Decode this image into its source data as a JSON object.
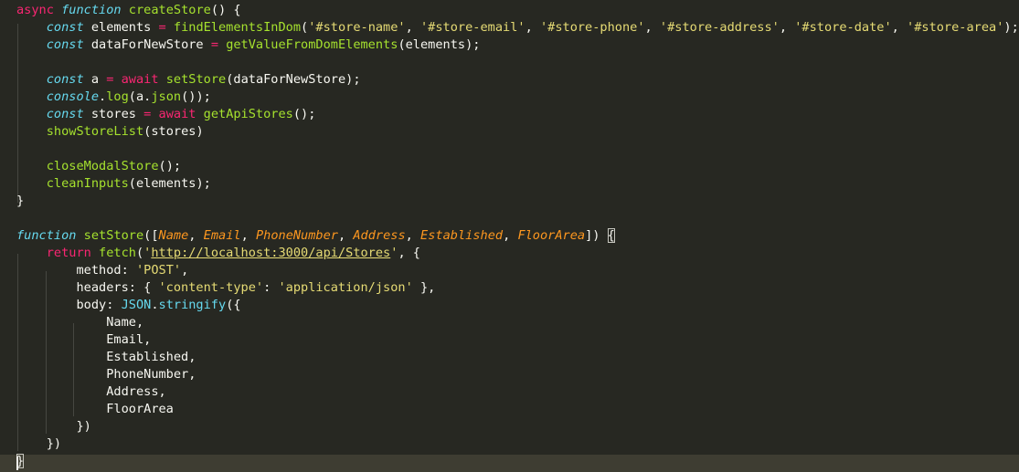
{
  "editor": {
    "lines": [
      [
        {
          "t": "async",
          "c": "kw"
        },
        {
          "t": " ",
          "c": "pl"
        },
        {
          "t": "function",
          "c": "st"
        },
        {
          "t": " ",
          "c": "pl"
        },
        {
          "t": "createStore",
          "c": "fn"
        },
        {
          "t": "() {",
          "c": "pl"
        }
      ],
      [
        {
          "t": "    ",
          "c": "pl"
        },
        {
          "t": "const",
          "c": "st"
        },
        {
          "t": " elements ",
          "c": "pl"
        },
        {
          "t": "=",
          "c": "kw"
        },
        {
          "t": " ",
          "c": "pl"
        },
        {
          "t": "findElementsInDom",
          "c": "fn"
        },
        {
          "t": "(",
          "c": "pl"
        },
        {
          "t": "'#store-name'",
          "c": "str"
        },
        {
          "t": ", ",
          "c": "pl"
        },
        {
          "t": "'#store-email'",
          "c": "str"
        },
        {
          "t": ", ",
          "c": "pl"
        },
        {
          "t": "'#store-phone'",
          "c": "str"
        },
        {
          "t": ", ",
          "c": "pl"
        },
        {
          "t": "'#store-address'",
          "c": "str"
        },
        {
          "t": ", ",
          "c": "pl"
        },
        {
          "t": "'#store-date'",
          "c": "str"
        },
        {
          "t": ", ",
          "c": "pl"
        },
        {
          "t": "'#store-area'",
          "c": "str"
        },
        {
          "t": ");",
          "c": "pl"
        }
      ],
      [
        {
          "t": "    ",
          "c": "pl"
        },
        {
          "t": "const",
          "c": "st"
        },
        {
          "t": " dataForNewStore ",
          "c": "pl"
        },
        {
          "t": "=",
          "c": "kw"
        },
        {
          "t": " ",
          "c": "pl"
        },
        {
          "t": "getValueFromDomElements",
          "c": "fn"
        },
        {
          "t": "(elements);",
          "c": "pl"
        }
      ],
      [],
      [
        {
          "t": "    ",
          "c": "pl"
        },
        {
          "t": "const",
          "c": "st"
        },
        {
          "t": " a ",
          "c": "pl"
        },
        {
          "t": "=",
          "c": "kw"
        },
        {
          "t": " ",
          "c": "pl"
        },
        {
          "t": "await",
          "c": "kw"
        },
        {
          "t": " ",
          "c": "pl"
        },
        {
          "t": "setStore",
          "c": "fn"
        },
        {
          "t": "(dataForNewStore);",
          "c": "pl"
        }
      ],
      [
        {
          "t": "    ",
          "c": "pl"
        },
        {
          "t": "console",
          "c": "st"
        },
        {
          "t": ".",
          "c": "pl"
        },
        {
          "t": "log",
          "c": "fn"
        },
        {
          "t": "(a.",
          "c": "pl"
        },
        {
          "t": "json",
          "c": "fn"
        },
        {
          "t": "());",
          "c": "pl"
        }
      ],
      [
        {
          "t": "    ",
          "c": "pl"
        },
        {
          "t": "const",
          "c": "st"
        },
        {
          "t": " stores ",
          "c": "pl"
        },
        {
          "t": "=",
          "c": "kw"
        },
        {
          "t": " ",
          "c": "pl"
        },
        {
          "t": "await",
          "c": "kw"
        },
        {
          "t": " ",
          "c": "pl"
        },
        {
          "t": "getApiStores",
          "c": "fn"
        },
        {
          "t": "();",
          "c": "pl"
        }
      ],
      [
        {
          "t": "    ",
          "c": "pl"
        },
        {
          "t": "showStoreList",
          "c": "fn"
        },
        {
          "t": "(stores)",
          "c": "pl"
        }
      ],
      [],
      [
        {
          "t": "    ",
          "c": "pl"
        },
        {
          "t": "closeModalStore",
          "c": "fn"
        },
        {
          "t": "();",
          "c": "pl"
        }
      ],
      [
        {
          "t": "    ",
          "c": "pl"
        },
        {
          "t": "cleanInputs",
          "c": "fn"
        },
        {
          "t": "(elements);",
          "c": "pl"
        }
      ],
      [
        {
          "t": "}",
          "c": "pl"
        }
      ],
      [],
      [
        {
          "t": "function",
          "c": "st"
        },
        {
          "t": " ",
          "c": "pl"
        },
        {
          "t": "setStore",
          "c": "fn"
        },
        {
          "t": "([",
          "c": "pl"
        },
        {
          "t": "Name",
          "c": "pm"
        },
        {
          "t": ", ",
          "c": "pl"
        },
        {
          "t": "Email",
          "c": "pm"
        },
        {
          "t": ", ",
          "c": "pl"
        },
        {
          "t": "PhoneNumber",
          "c": "pm"
        },
        {
          "t": ", ",
          "c": "pl"
        },
        {
          "t": "Address",
          "c": "pm"
        },
        {
          "t": ", ",
          "c": "pl"
        },
        {
          "t": "Established",
          "c": "pm"
        },
        {
          "t": ", ",
          "c": "pl"
        },
        {
          "t": "FloorArea",
          "c": "pm"
        },
        {
          "t": "]) ",
          "c": "pl"
        },
        {
          "t": "{",
          "c": "pl",
          "m": 1
        }
      ],
      [
        {
          "t": "    ",
          "c": "pl"
        },
        {
          "t": "return",
          "c": "kw"
        },
        {
          "t": " ",
          "c": "pl"
        },
        {
          "t": "fetch",
          "c": "fn"
        },
        {
          "t": "(",
          "c": "pl"
        },
        {
          "t": "'",
          "c": "str"
        },
        {
          "t": "http://localhost:3000/api/Stores",
          "c": "url"
        },
        {
          "t": "'",
          "c": "str"
        },
        {
          "t": ", {",
          "c": "pl"
        }
      ],
      [
        {
          "t": "        method: ",
          "c": "pl"
        },
        {
          "t": "'POST'",
          "c": "str"
        },
        {
          "t": ",",
          "c": "pl"
        }
      ],
      [
        {
          "t": "        headers: { ",
          "c": "pl"
        },
        {
          "t": "'content-type'",
          "c": "str"
        },
        {
          "t": ": ",
          "c": "pl"
        },
        {
          "t": "'application/json'",
          "c": "str"
        },
        {
          "t": " },",
          "c": "pl"
        }
      ],
      [
        {
          "t": "        body: ",
          "c": "pl"
        },
        {
          "t": "JSON",
          "c": "sup"
        },
        {
          "t": ".",
          "c": "pl"
        },
        {
          "t": "stringify",
          "c": "sup"
        },
        {
          "t": "({",
          "c": "pl"
        }
      ],
      [
        {
          "t": "            Name,",
          "c": "pl"
        }
      ],
      [
        {
          "t": "            Email,",
          "c": "pl"
        }
      ],
      [
        {
          "t": "            Established,",
          "c": "pl"
        }
      ],
      [
        {
          "t": "            PhoneNumber,",
          "c": "pl"
        }
      ],
      [
        {
          "t": "            Address,",
          "c": "pl"
        }
      ],
      [
        {
          "t": "            FloorArea",
          "c": "pl"
        }
      ],
      [
        {
          "t": "        })",
          "c": "pl"
        }
      ],
      [
        {
          "t": "    })",
          "c": "pl"
        }
      ],
      [
        {
          "t": "}",
          "c": "pl",
          "m": 1
        }
      ]
    ]
  },
  "colors": {
    "background": "#272822",
    "keyword": "#f92672",
    "storage": "#66d9ef",
    "function": "#a6e22e",
    "string": "#e6db74",
    "parameter": "#fd971f",
    "text": "#f8f8f2"
  }
}
